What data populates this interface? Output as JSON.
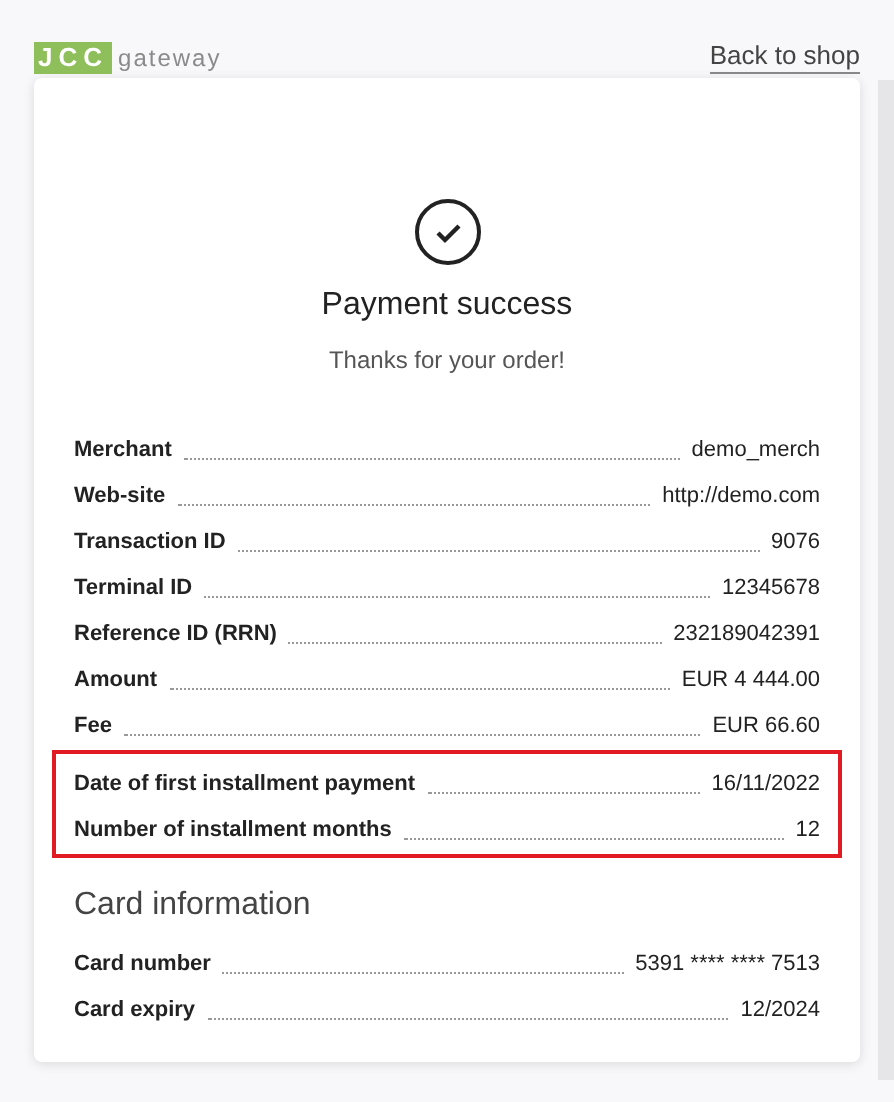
{
  "header": {
    "logo": {
      "mark": "JCC",
      "text": "gateway"
    },
    "back_link": "Back to shop"
  },
  "status": {
    "title": "Payment success",
    "subtitle": "Thanks for your order!"
  },
  "details": [
    {
      "label": "Merchant",
      "value": "demo_merch",
      "highlighted": false
    },
    {
      "label": "Web-site",
      "value": "http://demo.com",
      "highlighted": false
    },
    {
      "label": "Transaction ID",
      "value": "9076",
      "highlighted": false
    },
    {
      "label": "Terminal ID",
      "value": "12345678",
      "highlighted": false
    },
    {
      "label": "Reference ID (RRN)",
      "value": "232189042391",
      "highlighted": false
    },
    {
      "label": "Amount",
      "value": "EUR 4 444.00",
      "highlighted": false
    },
    {
      "label": "Fee",
      "value": "EUR 66.60",
      "highlighted": false
    },
    {
      "label": "Date of first installment payment",
      "value": "16/11/2022",
      "highlighted": true
    },
    {
      "label": "Number of installment months",
      "value": "12",
      "highlighted": true
    }
  ],
  "card_information": {
    "title": "Card information",
    "rows": [
      {
        "label": "Card number",
        "value": "5391 **** **** 7513"
      },
      {
        "label": "Card expiry",
        "value": "12/2024"
      }
    ]
  }
}
